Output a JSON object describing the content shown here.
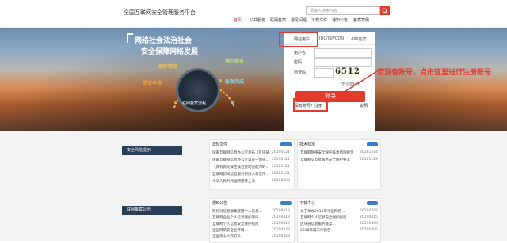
{
  "header": {
    "title": "全国互联网安全管理服务平台",
    "search_placeholder": "请输入搜索内容"
  },
  "nav": {
    "items": [
      "首页",
      "公共服务",
      "联网备案",
      "常见问题",
      "法规文件",
      "通知公告",
      "备案案例"
    ],
    "active": 0
  },
  "banner": {
    "slogan_line1": "网络社会法治社会",
    "slogan_line2": "安全保障网络发展",
    "steps": [
      "初步审核",
      "提交申请",
      "预约检查",
      "备案完成"
    ],
    "gauge_label": "联网备案流程"
  },
  "login": {
    "tabs": [
      "网站用户",
      "IDC/ISP/CDN",
      "APP备案"
    ],
    "username_label": "用户名",
    "password_label": "密码",
    "captcha_label": "验证码",
    "captcha_value": "6512",
    "forgot": "忘记密码？",
    "button": "登录",
    "register_link": "没有账号？注册",
    "help": "说明"
  },
  "annotation": "若没有账号，点击这里进行注册账号",
  "left_labels": [
    "安全风险提示",
    "联网备案公示"
  ],
  "panels": {
    "laws": {
      "title": "法规文件",
      "rows": [
        {
          "text": "国家互联网信息办公室发布《区块链…",
          "date": "20190121"
        },
        {
          "text": "国家互联网信息办公室等关于加强…",
          "date": "20190121"
        },
        {
          "text": "《具有舆论属性或社会动员能力的…",
          "date": "20181121"
        },
        {
          "text": "互联网新闻信息服务新技术新应用…",
          "date": "20181121"
        },
        {
          "text": "中华人民共和国网络安全法",
          "date": "20160828"
        }
      ]
    },
    "tech": {
      "title": "技术标准",
      "rows": [
        {
          "text": "互联网网络安全保护技术措施规定",
          "date": "20181214"
        },
        {
          "text": "互联网交互式服务安全保护要求",
          "date": "20181123"
        }
      ]
    },
    "notices": {
      "title": "通知公告",
      "rows": [
        {
          "text": "网民对信息收集使用个人信息…",
          "date": "20190619"
        },
        {
          "text": "互联网企业个人信息保护测评…",
          "date": "20190418"
        },
        {
          "text": "互联网个人信息安全保护指南",
          "date": "20190410"
        },
        {
          "text": "全国网络安全宣传周…",
          "date": "20190328"
        },
        {
          "text": "全国第十六次打私…",
          "date": "20190328"
        }
      ]
    },
    "download": {
      "title": "下载中心",
      "rows": [
        {
          "text": "关于举办2019年中国网络…",
          "date": "20190708"
        },
        {
          "text": "互联网个人信息安全保护指南",
          "date": "20190415"
        },
        {
          "text": "区块链信息服务备案…",
          "date": "20190306"
        },
        {
          "text": "2018年度工作报告",
          "date": "20190306"
        }
      ]
    }
  },
  "colors": {
    "accent": "#e23b2b",
    "nav_active": "#d9261c",
    "side_label_bg": "#2b3e59",
    "more_badge": "#3a7dc9"
  }
}
